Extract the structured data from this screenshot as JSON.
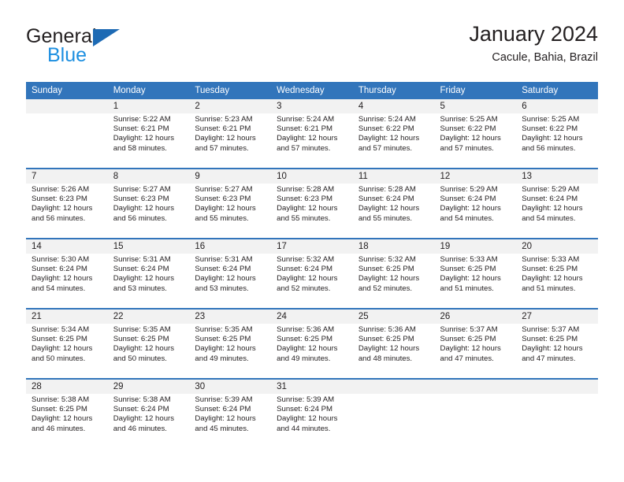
{
  "brand": {
    "name_part1": "General",
    "name_part2": "Blue",
    "triangle_color": "#1d6ab4",
    "blue_text_color": "#1d8fe0"
  },
  "header": {
    "title": "January 2024",
    "location": "Cacule, Bahia, Brazil"
  },
  "theme": {
    "header_bg": "#3275bb",
    "header_text": "#ffffff",
    "daynum_bg": "#f2f2f2",
    "cell_bg": "#ffffff",
    "text": "#231f20"
  },
  "weekdays": [
    "Sunday",
    "Monday",
    "Tuesday",
    "Wednesday",
    "Thursday",
    "Friday",
    "Saturday"
  ],
  "weeks": [
    {
      "days": [
        {
          "num": "",
          "sunrise": "",
          "sunset": "",
          "daylight1": "",
          "daylight2": ""
        },
        {
          "num": "1",
          "sunrise": "Sunrise: 5:22 AM",
          "sunset": "Sunset: 6:21 PM",
          "daylight1": "Daylight: 12 hours",
          "daylight2": "and 58 minutes."
        },
        {
          "num": "2",
          "sunrise": "Sunrise: 5:23 AM",
          "sunset": "Sunset: 6:21 PM",
          "daylight1": "Daylight: 12 hours",
          "daylight2": "and 57 minutes."
        },
        {
          "num": "3",
          "sunrise": "Sunrise: 5:24 AM",
          "sunset": "Sunset: 6:21 PM",
          "daylight1": "Daylight: 12 hours",
          "daylight2": "and 57 minutes."
        },
        {
          "num": "4",
          "sunrise": "Sunrise: 5:24 AM",
          "sunset": "Sunset: 6:22 PM",
          "daylight1": "Daylight: 12 hours",
          "daylight2": "and 57 minutes."
        },
        {
          "num": "5",
          "sunrise": "Sunrise: 5:25 AM",
          "sunset": "Sunset: 6:22 PM",
          "daylight1": "Daylight: 12 hours",
          "daylight2": "and 57 minutes."
        },
        {
          "num": "6",
          "sunrise": "Sunrise: 5:25 AM",
          "sunset": "Sunset: 6:22 PM",
          "daylight1": "Daylight: 12 hours",
          "daylight2": "and 56 minutes."
        }
      ]
    },
    {
      "days": [
        {
          "num": "7",
          "sunrise": "Sunrise: 5:26 AM",
          "sunset": "Sunset: 6:23 PM",
          "daylight1": "Daylight: 12 hours",
          "daylight2": "and 56 minutes."
        },
        {
          "num": "8",
          "sunrise": "Sunrise: 5:27 AM",
          "sunset": "Sunset: 6:23 PM",
          "daylight1": "Daylight: 12 hours",
          "daylight2": "and 56 minutes."
        },
        {
          "num": "9",
          "sunrise": "Sunrise: 5:27 AM",
          "sunset": "Sunset: 6:23 PM",
          "daylight1": "Daylight: 12 hours",
          "daylight2": "and 55 minutes."
        },
        {
          "num": "10",
          "sunrise": "Sunrise: 5:28 AM",
          "sunset": "Sunset: 6:23 PM",
          "daylight1": "Daylight: 12 hours",
          "daylight2": "and 55 minutes."
        },
        {
          "num": "11",
          "sunrise": "Sunrise: 5:28 AM",
          "sunset": "Sunset: 6:24 PM",
          "daylight1": "Daylight: 12 hours",
          "daylight2": "and 55 minutes."
        },
        {
          "num": "12",
          "sunrise": "Sunrise: 5:29 AM",
          "sunset": "Sunset: 6:24 PM",
          "daylight1": "Daylight: 12 hours",
          "daylight2": "and 54 minutes."
        },
        {
          "num": "13",
          "sunrise": "Sunrise: 5:29 AM",
          "sunset": "Sunset: 6:24 PM",
          "daylight1": "Daylight: 12 hours",
          "daylight2": "and 54 minutes."
        }
      ]
    },
    {
      "days": [
        {
          "num": "14",
          "sunrise": "Sunrise: 5:30 AM",
          "sunset": "Sunset: 6:24 PM",
          "daylight1": "Daylight: 12 hours",
          "daylight2": "and 54 minutes."
        },
        {
          "num": "15",
          "sunrise": "Sunrise: 5:31 AM",
          "sunset": "Sunset: 6:24 PM",
          "daylight1": "Daylight: 12 hours",
          "daylight2": "and 53 minutes."
        },
        {
          "num": "16",
          "sunrise": "Sunrise: 5:31 AM",
          "sunset": "Sunset: 6:24 PM",
          "daylight1": "Daylight: 12 hours",
          "daylight2": "and 53 minutes."
        },
        {
          "num": "17",
          "sunrise": "Sunrise: 5:32 AM",
          "sunset": "Sunset: 6:24 PM",
          "daylight1": "Daylight: 12 hours",
          "daylight2": "and 52 minutes."
        },
        {
          "num": "18",
          "sunrise": "Sunrise: 5:32 AM",
          "sunset": "Sunset: 6:25 PM",
          "daylight1": "Daylight: 12 hours",
          "daylight2": "and 52 minutes."
        },
        {
          "num": "19",
          "sunrise": "Sunrise: 5:33 AM",
          "sunset": "Sunset: 6:25 PM",
          "daylight1": "Daylight: 12 hours",
          "daylight2": "and 51 minutes."
        },
        {
          "num": "20",
          "sunrise": "Sunrise: 5:33 AM",
          "sunset": "Sunset: 6:25 PM",
          "daylight1": "Daylight: 12 hours",
          "daylight2": "and 51 minutes."
        }
      ]
    },
    {
      "days": [
        {
          "num": "21",
          "sunrise": "Sunrise: 5:34 AM",
          "sunset": "Sunset: 6:25 PM",
          "daylight1": "Daylight: 12 hours",
          "daylight2": "and 50 minutes."
        },
        {
          "num": "22",
          "sunrise": "Sunrise: 5:35 AM",
          "sunset": "Sunset: 6:25 PM",
          "daylight1": "Daylight: 12 hours",
          "daylight2": "and 50 minutes."
        },
        {
          "num": "23",
          "sunrise": "Sunrise: 5:35 AM",
          "sunset": "Sunset: 6:25 PM",
          "daylight1": "Daylight: 12 hours",
          "daylight2": "and 49 minutes."
        },
        {
          "num": "24",
          "sunrise": "Sunrise: 5:36 AM",
          "sunset": "Sunset: 6:25 PM",
          "daylight1": "Daylight: 12 hours",
          "daylight2": "and 49 minutes."
        },
        {
          "num": "25",
          "sunrise": "Sunrise: 5:36 AM",
          "sunset": "Sunset: 6:25 PM",
          "daylight1": "Daylight: 12 hours",
          "daylight2": "and 48 minutes."
        },
        {
          "num": "26",
          "sunrise": "Sunrise: 5:37 AM",
          "sunset": "Sunset: 6:25 PM",
          "daylight1": "Daylight: 12 hours",
          "daylight2": "and 47 minutes."
        },
        {
          "num": "27",
          "sunrise": "Sunrise: 5:37 AM",
          "sunset": "Sunset: 6:25 PM",
          "daylight1": "Daylight: 12 hours",
          "daylight2": "and 47 minutes."
        }
      ]
    },
    {
      "days": [
        {
          "num": "28",
          "sunrise": "Sunrise: 5:38 AM",
          "sunset": "Sunset: 6:25 PM",
          "daylight1": "Daylight: 12 hours",
          "daylight2": "and 46 minutes."
        },
        {
          "num": "29",
          "sunrise": "Sunrise: 5:38 AM",
          "sunset": "Sunset: 6:24 PM",
          "daylight1": "Daylight: 12 hours",
          "daylight2": "and 46 minutes."
        },
        {
          "num": "30",
          "sunrise": "Sunrise: 5:39 AM",
          "sunset": "Sunset: 6:24 PM",
          "daylight1": "Daylight: 12 hours",
          "daylight2": "and 45 minutes."
        },
        {
          "num": "31",
          "sunrise": "Sunrise: 5:39 AM",
          "sunset": "Sunset: 6:24 PM",
          "daylight1": "Daylight: 12 hours",
          "daylight2": "and 44 minutes."
        },
        {
          "num": "",
          "sunrise": "",
          "sunset": "",
          "daylight1": "",
          "daylight2": ""
        },
        {
          "num": "",
          "sunrise": "",
          "sunset": "",
          "daylight1": "",
          "daylight2": ""
        },
        {
          "num": "",
          "sunrise": "",
          "sunset": "",
          "daylight1": "",
          "daylight2": ""
        }
      ]
    }
  ]
}
